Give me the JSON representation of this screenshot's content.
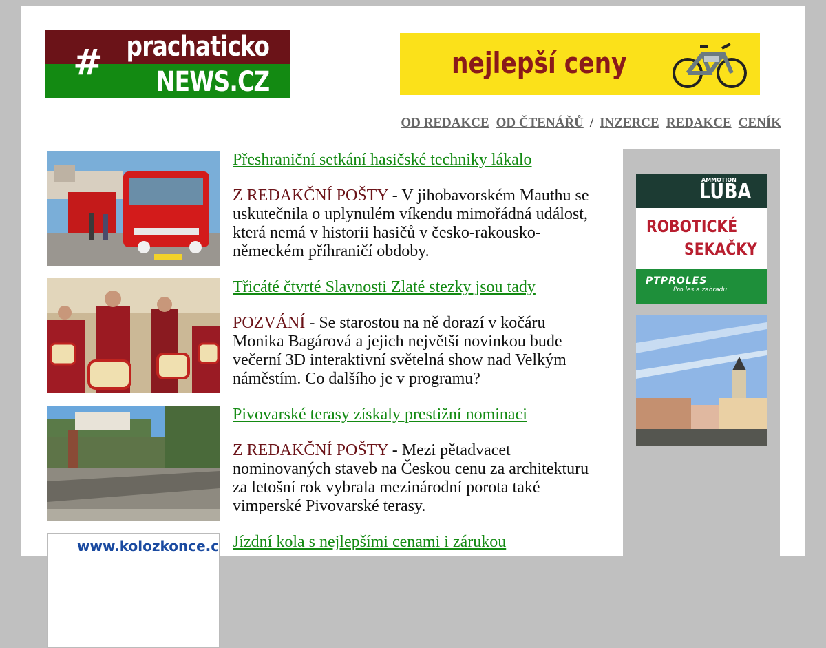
{
  "logo": {
    "symbol": "#",
    "line1": "prachaticko",
    "line2": "NEWS.CZ",
    "colors": {
      "top": "#6b1318",
      "bottom": "#138a12"
    }
  },
  "banner": {
    "text": "nejlepší ceny",
    "image": "electric-bike-icon"
  },
  "nav": {
    "items": [
      "OD REDAKCE",
      "OD ČTENÁŘŮ",
      "INZERCE",
      "REDAKCE",
      "CENÍK"
    ],
    "separator": "/"
  },
  "articles": [
    {
      "title": "Přeshraniční setkání hasičské techniky lákalo",
      "category": "Z REDAKČNÍ POŠTY",
      "text": " - V jihobavorském Mauthu se uskutečnila o uplynulém víkendu mimořádná událost, která nemá v historii hasičů v česko-rakousko-německém příhraničí obdoby.",
      "image": "fire-truck-photo"
    },
    {
      "title": "Třicáté čtvrté Slavnosti Zlaté stezky jsou tady",
      "category": "POZVÁNÍ",
      "text": " - Se starostou na ně dorazí v kočáru Monika Bagárová a jejich největší novinkou bude večerní 3D interaktivní světelná show nad Velkým náměstím. Co dalšího je v programu?",
      "image": "drummers-parade-photo"
    },
    {
      "title": "Pivovarské terasy získaly prestižní nominaci",
      "category": "Z REDAKČNÍ POŠTY",
      "text": " - Mezi pětadvacet nominovaných staveb na Českou cenu za architekturu za letošní rok vybrala mezinárodní porota také vimperské Pivovarské terasy.",
      "image": "brewery-terraces-photo"
    },
    {
      "title": "Jízdní kola s nejlepšími cenami i zárukou",
      "category": "",
      "text": "",
      "image": "kolozkonce-logo",
      "thumb_text": "www.kolozkonce.cz"
    }
  ],
  "sidebar": {
    "ad1": {
      "brand_small": "AMMOTION",
      "brand": "LUBA",
      "line1": "ROBOTICKÉ",
      "line2": "SEKAČKY",
      "footer_brand": "PTPROLES",
      "footer_tagline": "Pro les a zahradu"
    },
    "ad2": {
      "image": "town-square-photo"
    }
  },
  "colors": {
    "title_green": "#138a12",
    "category_maroon": "#6b1318",
    "nav_gray": "#666666",
    "banner_yellow": "#fbe11a"
  }
}
